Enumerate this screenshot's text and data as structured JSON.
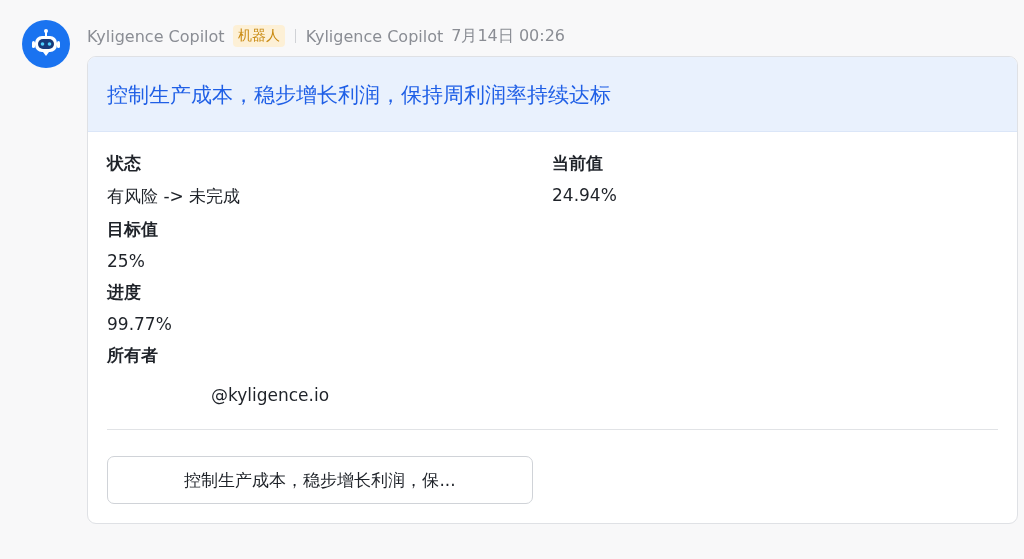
{
  "message": {
    "sender": "Kyligence Copilot",
    "badge": "机器人",
    "app_name": "Kyligence Copilot",
    "time": "7月14日 00:26"
  },
  "card": {
    "title": "控制生产成本，稳步增长利润，保持周利润率持续达标",
    "columns": [
      [
        {
          "label": "状态",
          "value": "有风险 -> 未完成"
        },
        {
          "label": "目标值",
          "value": "25%"
        },
        {
          "label": "进度",
          "value": "99.77%"
        },
        {
          "label": "所有者",
          "value": "@kyligence.io",
          "kind": "owner"
        }
      ],
      [
        {
          "label": "当前值",
          "value": "24.94%"
        }
      ]
    ],
    "button": "控制生产成本，稳步增长利润，保..."
  }
}
